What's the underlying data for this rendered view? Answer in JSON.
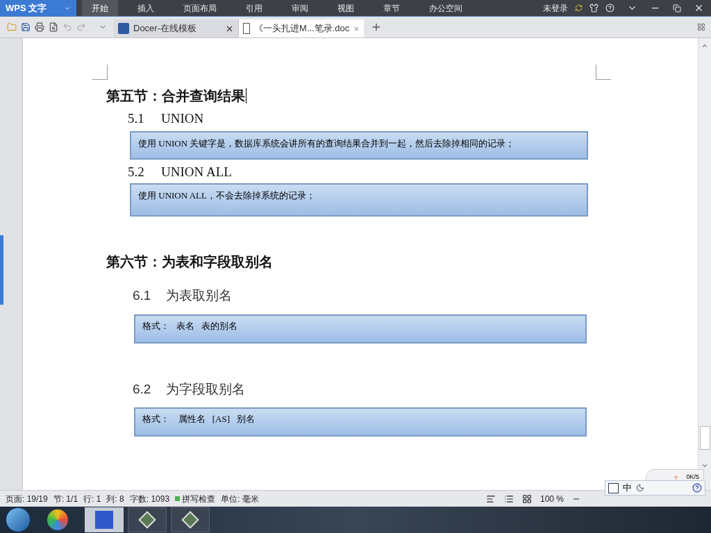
{
  "app_menu": {
    "label": "WPS 文字"
  },
  "menu_tabs": [
    {
      "label": "开始",
      "selected": true
    },
    {
      "label": "插入",
      "selected": false
    },
    {
      "label": "页面布局",
      "selected": false
    },
    {
      "label": "引用",
      "selected": false
    },
    {
      "label": "审阅",
      "selected": false
    },
    {
      "label": "视图",
      "selected": false
    },
    {
      "label": "章节",
      "selected": false
    },
    {
      "label": "办公空间",
      "selected": false
    }
  ],
  "account": "未登录",
  "doc_tabs": [
    {
      "label": "Docer-在线模板",
      "kind": "docer",
      "selected": false
    },
    {
      "label": "《一头扎进M...笔录.doc",
      "kind": "word",
      "selected": true
    }
  ],
  "document": {
    "blocks": [
      {
        "kind": "heading",
        "text": "第五节：合并查询结果"
      },
      {
        "kind": "subheading",
        "number": "5.1",
        "text": "UNION"
      },
      {
        "kind": "box",
        "text": "使用 UNION 关键字是，数据库系统会讲所有的查询结果合并到一起，然后去除掉相同的记录；"
      },
      {
        "kind": "subheading",
        "number": "5.2",
        "text": "UNION ALL"
      },
      {
        "kind": "box",
        "text": "使用 UNION ALL，不会去除掉系统的记录；"
      },
      {
        "kind": "heading",
        "text": "第六节：为表和字段取别名"
      },
      {
        "kind": "subheading_alt",
        "number": "6.1",
        "text": "为表取别名"
      },
      {
        "kind": "box_alt",
        "text": "格式：   表名   表的别名"
      },
      {
        "kind": "subheading_alt",
        "number": "6.2",
        "text": "为字段取别名"
      },
      {
        "kind": "box_alt",
        "text": "格式：    属性名   [AS]   别名"
      }
    ]
  },
  "status_bar": {
    "items": [
      "页面: 19/19",
      "节: 1/1",
      "行: 1",
      "列: 8",
      "字数: 1093"
    ],
    "spell_check": "拼写检查",
    "unit": "单位: 毫米",
    "zoom": "100 %"
  },
  "ime": {
    "mode": "中",
    "speed": "0K/5"
  }
}
